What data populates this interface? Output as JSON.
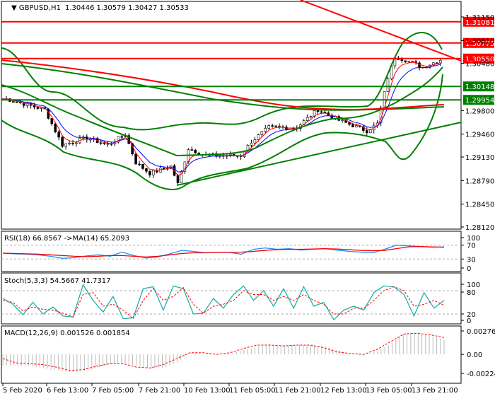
{
  "header": {
    "symbol": "GBPUSD,H1",
    "ohlc": "1.30446 1.30579 1.30427 1.30533"
  },
  "price_axis": [
    "1.31150",
    "1.30810",
    "1.30480",
    "1.29800",
    "1.29460",
    "1.29130",
    "1.28790",
    "1.28450",
    "1.28120"
  ],
  "levels": [
    {
      "value": "1.31081",
      "color": "#ff0000"
    },
    {
      "value": "1.30775",
      "color": "#ff0000"
    },
    {
      "value": "1.30550",
      "color": "#ff0000"
    },
    {
      "value": "1.30148",
      "color": "#008000"
    },
    {
      "value": "1.29954",
      "color": "#008000"
    }
  ],
  "price_path": [
    [
      1,
      1.29967
    ],
    [
      12,
      1.29814
    ],
    [
      17,
      1.29303
    ],
    [
      24,
      1.29405
    ],
    [
      30,
      1.29303
    ],
    [
      35,
      1.29456
    ],
    [
      38,
      1.29048
    ],
    [
      42,
      1.28895
    ],
    [
      48,
      1.28997
    ],
    [
      50,
      1.28742
    ],
    [
      53,
      1.29252
    ],
    [
      58,
      1.2915
    ],
    [
      68,
      1.2915
    ],
    [
      71,
      1.29354
    ],
    [
      76,
      1.29558
    ],
    [
      84,
      1.29558
    ],
    [
      90,
      1.29814
    ],
    [
      96,
      1.2966
    ],
    [
      104,
      1.29507
    ],
    [
      107,
      1.29609
    ],
    [
      110,
      1.30273
    ],
    [
      112,
      1.30579
    ],
    [
      115,
      1.30528
    ],
    [
      120,
      1.30426
    ],
    [
      125,
      1.30533
    ]
  ],
  "rsi": {
    "label": "RSI(18) 66.8567  ->MA(14) 65.2093",
    "axis": [
      "100",
      "70",
      "30",
      "0"
    ],
    "values": [
      47,
      45,
      44,
      42,
      38,
      32,
      34,
      39,
      42,
      38,
      50,
      40,
      33,
      36,
      45,
      55,
      52,
      48,
      49,
      49,
      44,
      58,
      62,
      58,
      60,
      56,
      58,
      60,
      56,
      52,
      50,
      48,
      58,
      70,
      68,
      66,
      64,
      65
    ],
    "ma": [
      47,
      46,
      45,
      44,
      42,
      40,
      38,
      37,
      38,
      40,
      40,
      38,
      36,
      38,
      42,
      46,
      48,
      48,
      49,
      49,
      50,
      52,
      55,
      57,
      58,
      58,
      59,
      60,
      59,
      57,
      55,
      54,
      55,
      60,
      65,
      66,
      65,
      64
    ]
  },
  "stoch": {
    "label": "Stoch(5,3,3) 54.5667 41.7317",
    "axis": [
      "100",
      "80",
      "20",
      "0"
    ],
    "k": [
      60,
      45,
      18,
      50,
      20,
      38,
      15,
      12,
      95,
      55,
      25,
      65,
      8,
      10,
      85,
      90,
      30,
      92,
      85,
      20,
      22,
      60,
      35,
      70,
      92,
      55,
      80,
      40,
      85,
      35,
      90,
      40,
      50,
      5,
      30,
      40,
      30,
      75,
      92,
      90,
      70,
      15,
      75,
      35,
      55
    ],
    "d": [
      55,
      50,
      28,
      38,
      32,
      30,
      22,
      12,
      70,
      75,
      40,
      45,
      30,
      8,
      55,
      85,
      55,
      65,
      88,
      45,
      22,
      40,
      45,
      55,
      80,
      70,
      70,
      55,
      65,
      55,
      70,
      55,
      45,
      20,
      20,
      35,
      35,
      55,
      80,
      90,
      80,
      40,
      45,
      55,
      42
    ]
  },
  "macd": {
    "label": "MACD(12,26,9) 0.001526 0.001854",
    "axis": [
      "0.002769",
      "0.00",
      "-0.002241"
    ],
    "hist": [
      -0.0013,
      -0.0013,
      -0.0014,
      -0.0016,
      -0.0019,
      -0.0021,
      -0.002,
      -0.0016,
      -0.0012,
      -0.001,
      -0.0013,
      -0.0017,
      -0.0016,
      -0.001,
      0.0002,
      0.0001,
      0.0,
      0.0001,
      0.0005,
      0.0009,
      0.0011,
      0.0011,
      0.0011,
      0.0011,
      0.001,
      0.0005,
      0.0,
      -0.0001,
      0.0004,
      0.0012,
      0.0025,
      0.0026,
      0.0022,
      0.0017
    ],
    "signal": [
      -0.0005,
      -0.001,
      -0.0011,
      -0.0012,
      -0.0015,
      -0.0019,
      -0.0018,
      -0.0014,
      -0.0011,
      -0.0011,
      -0.0015,
      -0.0016,
      -0.0012,
      -0.0005,
      0.0002,
      0.0002,
      0.0,
      0.0002,
      0.0007,
      0.0011,
      0.0011,
      0.001,
      0.0011,
      0.0011,
      0.0008,
      0.0003,
      0.0001,
      0.0,
      0.0006,
      0.0015,
      0.0024,
      0.0025,
      0.0023,
      0.002
    ]
  },
  "time_axis": [
    "5 Feb 2020",
    "6 Feb 13:00",
    "7 Feb 05:00",
    "7 Feb 21:00",
    "10 Feb 13:00",
    "11 Feb 05:00",
    "11 Feb 21:00",
    "12 Feb 13:00",
    "13 Feb 05:00",
    "13 Feb 21:00"
  ]
}
